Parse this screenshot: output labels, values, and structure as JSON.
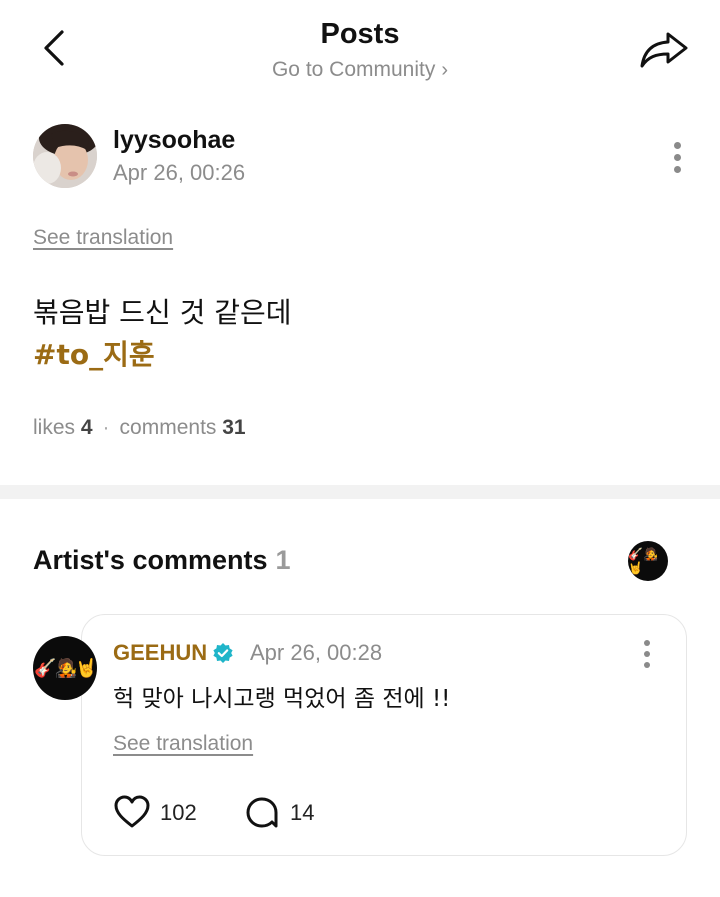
{
  "header": {
    "title": "Posts",
    "subtitle": "Go to Community",
    "back_icon": "chevron-left-icon",
    "share_icon": "share-icon"
  },
  "post": {
    "author_name": "lyysoohae",
    "date": "Apr 26, 00:26",
    "see_translation": "See translation",
    "body": "볶음밥 드신 것 같은데",
    "hashtag": "#to_지훈",
    "likes_label": "likes",
    "likes_count": "4",
    "comments_label": "comments",
    "comments_count": "31"
  },
  "artist_comments": {
    "title": "Artist's comments",
    "count": "1",
    "avatar_emoji": "🎸🧑‍🎤🤘",
    "items": [
      {
        "name": "GEEHUN",
        "verified": true,
        "date": "Apr 26, 00:28",
        "text": "헉 맞아 나시고랭 먹었어 좀 전에 !!",
        "see_translation": "See translation",
        "likes": "102",
        "replies": "14"
      }
    ]
  },
  "colors": {
    "accent_gold": "#9b6b14",
    "verified_teal": "#1fb5c9",
    "muted_text": "#8c8c8c",
    "divider": "#f2f2f2"
  }
}
